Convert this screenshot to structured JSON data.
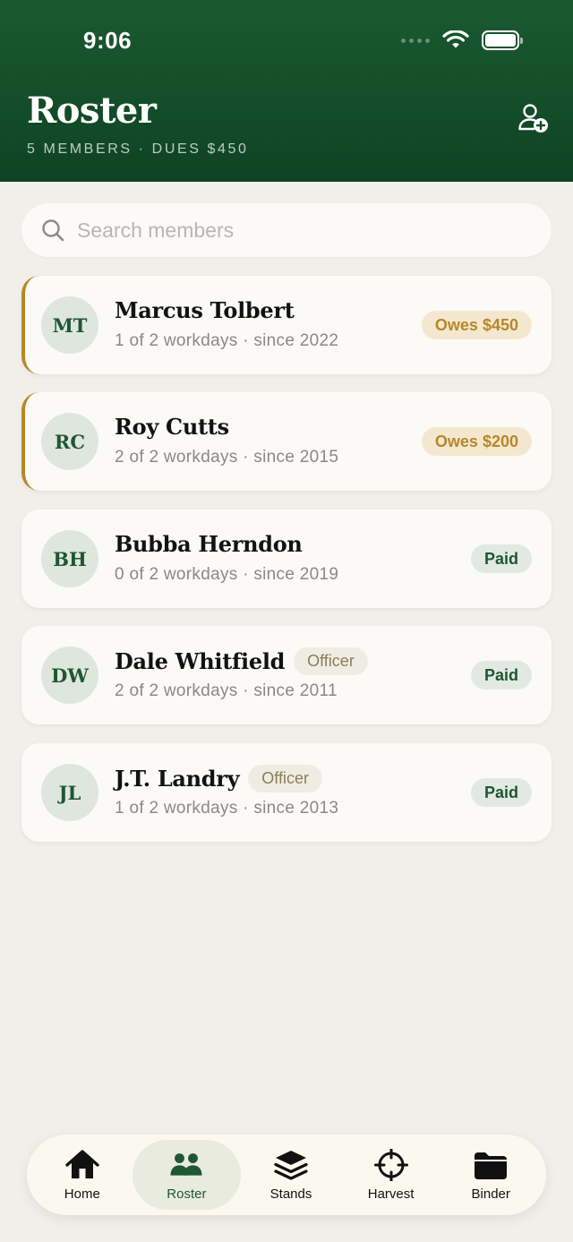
{
  "status": {
    "time": "9:06"
  },
  "header": {
    "title": "Roster",
    "subtitle": "5 MEMBERS · DUES $450"
  },
  "search": {
    "placeholder": "Search members"
  },
  "members": [
    {
      "initials": "MT",
      "name": "Marcus Tolbert",
      "meta": "1 of 2 workdays · since 2022",
      "badge": "Owes $450",
      "status": "owes",
      "role": ""
    },
    {
      "initials": "RC",
      "name": "Roy Cutts",
      "meta": "2 of 2 workdays · since 2015",
      "badge": "Owes $200",
      "status": "owes",
      "role": ""
    },
    {
      "initials": "BH",
      "name": "Bubba Herndon",
      "meta": "0 of 2 workdays · since 2019",
      "badge": "Paid",
      "status": "paid",
      "role": ""
    },
    {
      "initials": "DW",
      "name": "Dale Whitfield",
      "meta": "2 of 2 workdays · since 2011",
      "badge": "Paid",
      "status": "paid",
      "role": "Officer"
    },
    {
      "initials": "JL",
      "name": "J.T. Landry",
      "meta": "1 of 2 workdays · since 2013",
      "badge": "Paid",
      "status": "paid",
      "role": "Officer"
    }
  ],
  "tabs": [
    {
      "label": "Home",
      "icon": "home-icon"
    },
    {
      "label": "Roster",
      "icon": "people-icon",
      "active": true
    },
    {
      "label": "Stands",
      "icon": "layers-icon"
    },
    {
      "label": "Harvest",
      "icon": "crosshair-icon"
    },
    {
      "label": "Binder",
      "icon": "folder-icon"
    }
  ],
  "colors": {
    "brand": "#165230",
    "owes_accent": "#b98727",
    "background": "#f1efea"
  }
}
